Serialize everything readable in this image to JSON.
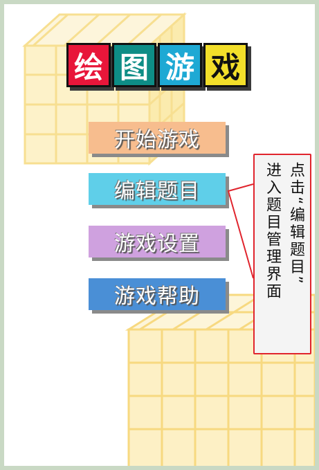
{
  "title": {
    "tiles": [
      {
        "char": "绘",
        "color": "#e8163a",
        "text_color": "#ffffff"
      },
      {
        "char": "图",
        "color": "#0e8d86",
        "text_color": "#ffffff"
      },
      {
        "char": "游",
        "color": "#1ea9d4",
        "text_color": "#ffffff"
      },
      {
        "char": "戏",
        "color": "#f3df2a",
        "text_color": "#111111"
      }
    ]
  },
  "menu": [
    {
      "label": "开始游戏",
      "color": "#f7bd8e"
    },
    {
      "label": "编辑题目",
      "color": "#5fcfe9"
    },
    {
      "label": "游戏设置",
      "color": "#cfa1df"
    },
    {
      "label": "游戏帮助",
      "color": "#4a8fd6"
    }
  ],
  "annotation": {
    "col1": "点击“编辑题目”",
    "col2": "进入题目管理界面",
    "border_color": "#e0242d"
  },
  "background": {
    "cube_color": "#fbe9a6"
  }
}
